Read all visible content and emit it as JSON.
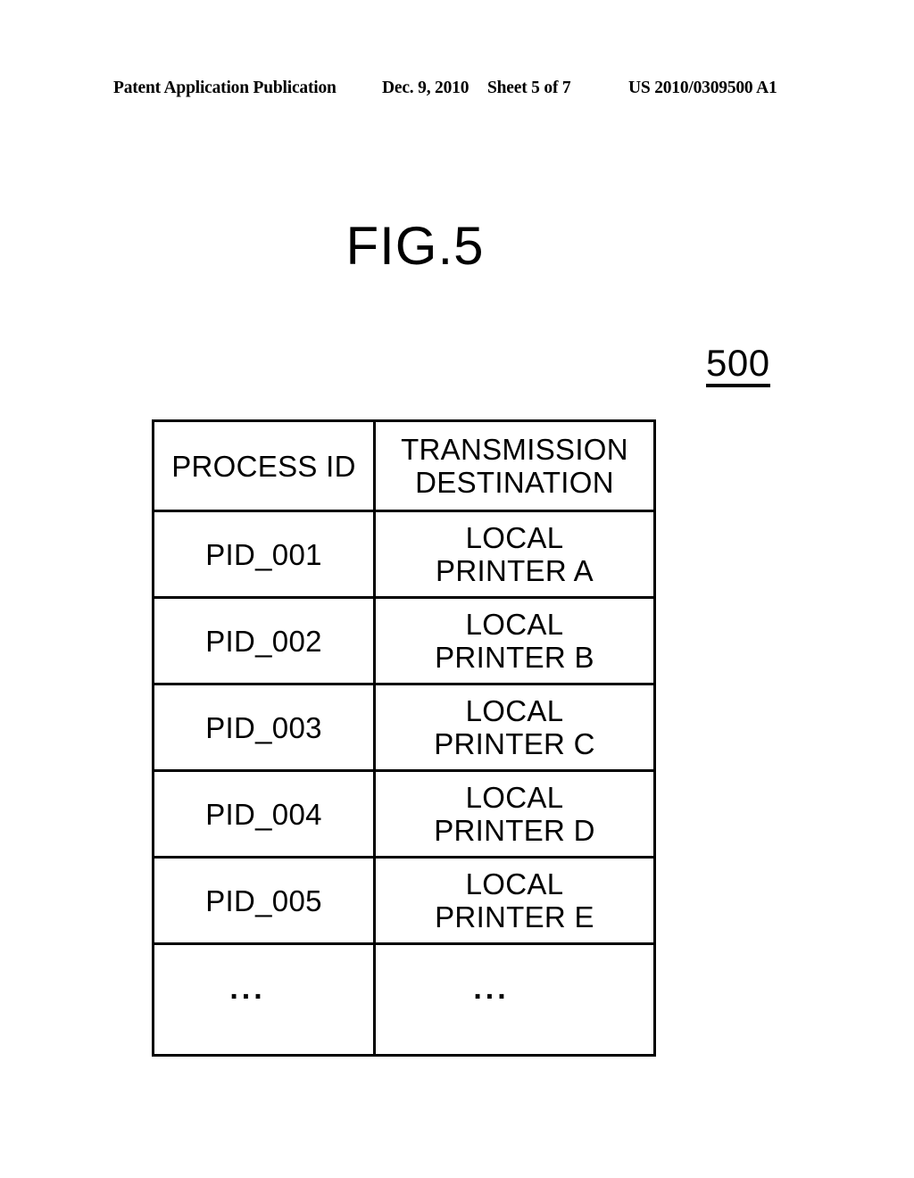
{
  "page_header": {
    "publication": "Patent Application Publication",
    "date": "Dec. 9, 2010",
    "sheet": "Sheet 5 of 7",
    "document_number": "US 2010/0309500 A1"
  },
  "figure": {
    "title": "FIG.5",
    "reference_numeral": "500"
  },
  "table": {
    "columns": [
      {
        "header": "PROCESS ID"
      },
      {
        "header_line1": "TRANSMISSION",
        "header_line2": "DESTINATION"
      }
    ],
    "rows": [
      {
        "process_id": "PID_001",
        "dest_line1": "LOCAL",
        "dest_line2": "PRINTER A"
      },
      {
        "process_id": "PID_002",
        "dest_line1": "LOCAL",
        "dest_line2": "PRINTER B"
      },
      {
        "process_id": "PID_003",
        "dest_line1": "LOCAL",
        "dest_line2": "PRINTER C"
      },
      {
        "process_id": "PID_004",
        "dest_line1": "LOCAL",
        "dest_line2": "PRINTER D"
      },
      {
        "process_id": "PID_005",
        "dest_line1": "LOCAL",
        "dest_line2": "PRINTER E"
      }
    ],
    "continuation_row": {
      "process_id": "...",
      "destination": "..."
    }
  },
  "colors": {
    "ink": "#000000",
    "paper": "#ffffff"
  }
}
